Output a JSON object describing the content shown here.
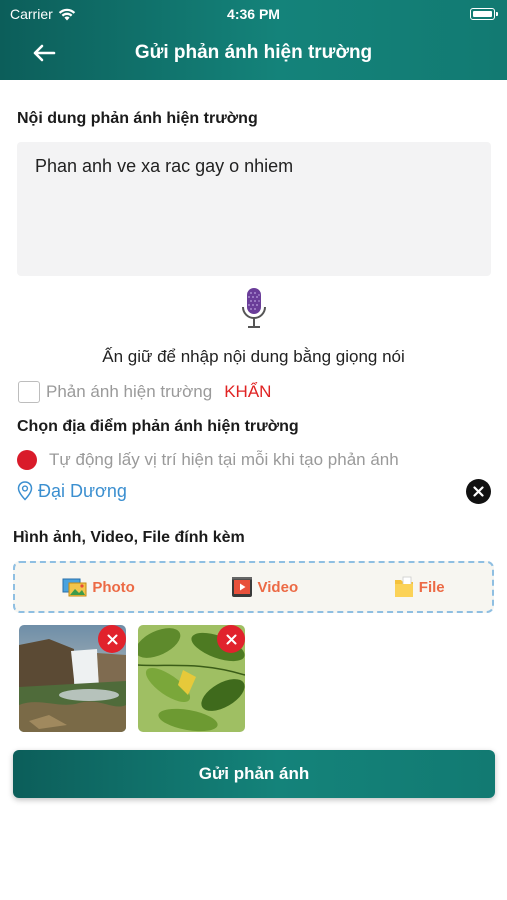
{
  "status_bar": {
    "carrier": "Carrier",
    "time": "4:36 PM"
  },
  "header": {
    "title": "Gửi phản ánh hiện trường"
  },
  "content": {
    "label": "Nội dung phản ánh hiện trường",
    "value": "Phan anh ve xa rac gay o nhiem",
    "voice_hint": "Ấn giữ để nhập nội dung bằng giọng nói"
  },
  "urgent": {
    "label": "Phản ánh hiện trường",
    "tag": "KHẨN",
    "checked": false
  },
  "location": {
    "label": "Chọn địa điểm phản ánh hiện trường",
    "auto_option": "Tự động lấy vị trí hiện tại mỗi khi tạo phản ánh",
    "selected": "Đại Dương"
  },
  "attachments": {
    "label": "Hình ảnh, Video, File đính kèm",
    "buttons": {
      "photo": "Photo",
      "video": "Video",
      "file": "File"
    }
  },
  "submit": {
    "label": "Gửi phản ánh"
  },
  "colors": {
    "header": "#127a72",
    "urgent": "#e02323",
    "link": "#3b8fd0",
    "attach_text": "#ec6a45",
    "remove_badge": "#e1222c"
  }
}
